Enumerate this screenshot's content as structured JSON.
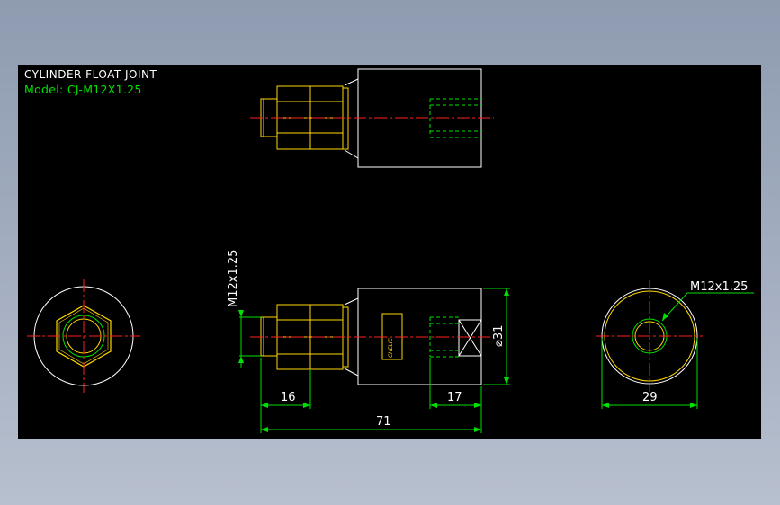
{
  "drawing": {
    "title": "CYLINDER FLOAT JOINT",
    "model_label": "Model: CJ-M12X1.25",
    "thread_label": "M12x1.25",
    "thread_callout": "M12x1.25",
    "dim_16": "16",
    "dim_17": "17",
    "dim_71": "71",
    "dim_29": "29",
    "dim_diameter": "⌀31",
    "brand_text": "CHELIC"
  },
  "colors": {
    "background": "#000000",
    "outline": "#ffffff",
    "detail": "#ffd700",
    "dimension": "#00e000",
    "centerline": "#ff2020",
    "hidden": "#00e000"
  }
}
